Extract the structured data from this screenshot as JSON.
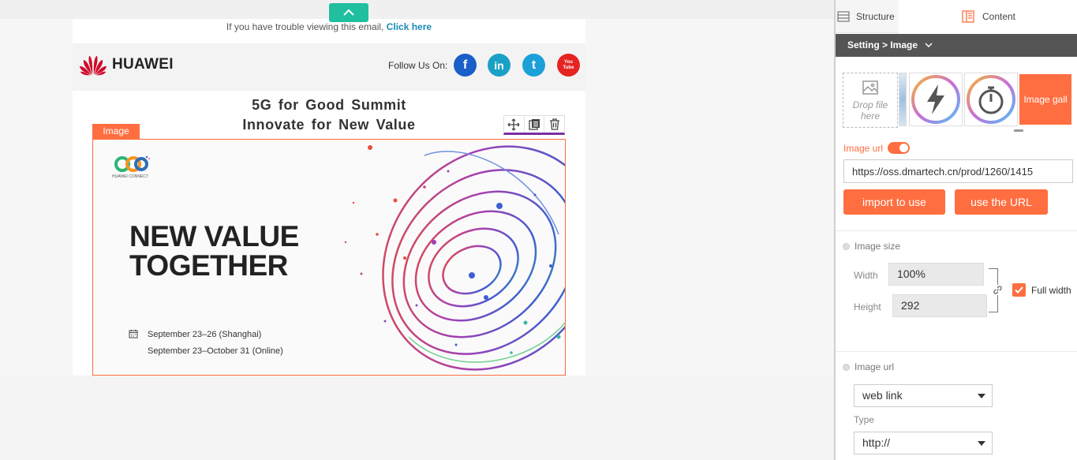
{
  "editor": {
    "collapse_icon": "chevron-up-icon"
  },
  "email": {
    "preheader_text": "If you have trouble viewing this email,",
    "preheader_link": "Click here",
    "brand_name": "HUAWEI",
    "follow_label": "Follow Us On:",
    "social": [
      {
        "name": "facebook",
        "glyph": "f",
        "color": "#1a5ec9"
      },
      {
        "name": "linkedin",
        "glyph": "in",
        "color": "#1aa0c6"
      },
      {
        "name": "twitter",
        "glyph": "t",
        "color": "#1ba0d8"
      },
      {
        "name": "youtube",
        "glyph": "You Tube",
        "color": "#e52421"
      }
    ],
    "title_line1": "5G for Good Summit",
    "title_line2": "Innovate for New Value",
    "image_tag": "Image",
    "hero": {
      "logo_caption": "HUAWEI CONNECT",
      "headline_line1": "NEW VALUE",
      "headline_line2": "TOGETHER",
      "date_line1": "September 23–26  (Shanghai)",
      "date_line2": "September 23–October 31  (Online)"
    }
  },
  "panel": {
    "tab_structure": "Structure",
    "tab_content": "Content",
    "breadcrumb": "Setting > Image",
    "dropzone_line1": "Drop file",
    "dropzone_line2": "here",
    "gallery_label": "Image gall",
    "image_url_label": "Image url",
    "image_url_enabled": true,
    "image_url_value": "https://oss.dmartech.cn/prod/1260/1415",
    "import_button": "import to use",
    "use_url_button": "use the URL",
    "image_size": {
      "title": "Image size",
      "width_label": "Width",
      "width_value": "100%",
      "height_label": "Height",
      "height_value": "292",
      "full_width_label": "Full width",
      "full_width_checked": true
    },
    "link": {
      "title": "Image url",
      "link_type_value": "web link",
      "type_label": "Type",
      "protocol_value": "http://"
    }
  },
  "colors": {
    "accent": "#ff6e40",
    "teal": "#1fbf9f",
    "setting_bar": "#555555"
  }
}
